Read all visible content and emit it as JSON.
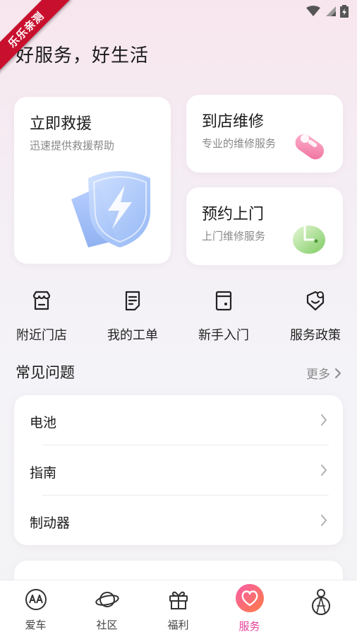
{
  "watermark": "乐乐亲测",
  "header": {
    "title": "好服务，好生活"
  },
  "cards": {
    "rescue": {
      "title": "立即救援",
      "subtitle": "迅速提供救援帮助",
      "icon": "shield-lightning-icon"
    },
    "repair": {
      "title": "到店维修",
      "subtitle": "专业的维修服务",
      "icon": "wrench-icon"
    },
    "visit": {
      "title": "预约上门",
      "subtitle": "上门维修服务",
      "icon": "clock-icon"
    }
  },
  "quick_actions": [
    {
      "label": "附近门店",
      "icon": "store-icon"
    },
    {
      "label": "我的工单",
      "icon": "document-icon"
    },
    {
      "label": "新手入门",
      "icon": "guide-icon"
    },
    {
      "label": "服务政策",
      "icon": "policy-icon"
    }
  ],
  "faq": {
    "title": "常见问题",
    "more_label": "更多",
    "items": [
      {
        "label": "电池"
      },
      {
        "label": "指南"
      },
      {
        "label": "制动器"
      }
    ]
  },
  "tabs": [
    {
      "label": "爱车",
      "icon": "car-logo-icon"
    },
    {
      "label": "社区",
      "icon": "planet-icon"
    },
    {
      "label": "福利",
      "icon": "gift-icon"
    },
    {
      "label": "服务",
      "icon": "heart-icon",
      "active": true
    },
    {
      "label": "",
      "icon": "profile-icon"
    }
  ],
  "colors": {
    "accent": "#e8409a",
    "ribbon": "#c8102e",
    "card_bg": "#ffffff"
  }
}
